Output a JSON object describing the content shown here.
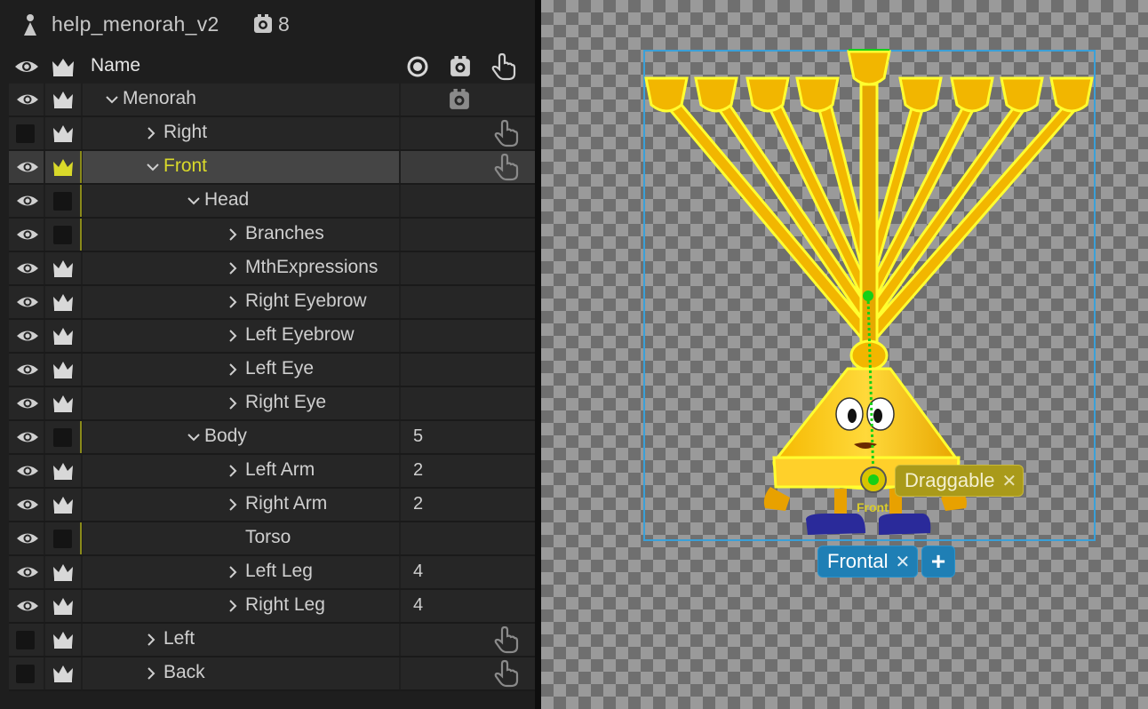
{
  "header": {
    "puppet_name": "help_menorah_v2",
    "count": "8"
  },
  "columns": {
    "name": "Name"
  },
  "rows": [
    {
      "label": "Menorah",
      "indent": 0,
      "expander": "open",
      "eye": true,
      "crown": "on",
      "yellow": false,
      "value": "",
      "icon": "gear"
    },
    {
      "label": "Right",
      "indent": 1,
      "expander": "closed",
      "eye": false,
      "crown": "on",
      "yellow": false,
      "value": "",
      "icon": "hand"
    },
    {
      "label": "Front",
      "indent": 1,
      "expander": "open",
      "eye": true,
      "crown": "yellow",
      "yellow": true,
      "value": "",
      "icon": "hand",
      "selected": true
    },
    {
      "label": "Head",
      "indent": 2,
      "expander": "open",
      "eye": true,
      "crown": "off",
      "yellow": false,
      "value": "",
      "icon": ""
    },
    {
      "label": "Branches",
      "indent": 3,
      "expander": "closed",
      "eye": true,
      "crown": "off",
      "yellow": false,
      "value": "",
      "icon": ""
    },
    {
      "label": "MthExpressions",
      "indent": 3,
      "expander": "closed",
      "eye": true,
      "crown": "on",
      "yellow": false,
      "value": "",
      "icon": ""
    },
    {
      "label": "Right Eyebrow",
      "indent": 3,
      "expander": "closed",
      "eye": true,
      "crown": "on",
      "yellow": false,
      "value": "",
      "icon": ""
    },
    {
      "label": "Left Eyebrow",
      "indent": 3,
      "expander": "closed",
      "eye": true,
      "crown": "on",
      "yellow": false,
      "value": "",
      "icon": ""
    },
    {
      "label": "Left Eye",
      "indent": 3,
      "expander": "closed",
      "eye": true,
      "crown": "on",
      "yellow": false,
      "value": "",
      "icon": ""
    },
    {
      "label": "Right Eye",
      "indent": 3,
      "expander": "closed",
      "eye": true,
      "crown": "on",
      "yellow": false,
      "value": "",
      "icon": ""
    },
    {
      "label": "Body",
      "indent": 2,
      "expander": "open",
      "eye": true,
      "crown": "off",
      "yellow": false,
      "value": "5",
      "icon": ""
    },
    {
      "label": "Left Arm",
      "indent": 3,
      "expander": "closed",
      "eye": true,
      "crown": "on",
      "yellow": false,
      "value": "2",
      "icon": ""
    },
    {
      "label": "Right Arm",
      "indent": 3,
      "expander": "closed",
      "eye": true,
      "crown": "on",
      "yellow": false,
      "value": "2",
      "icon": ""
    },
    {
      "label": "Torso",
      "indent": 3,
      "expander": "none",
      "eye": true,
      "crown": "off",
      "yellow": false,
      "value": "",
      "icon": ""
    },
    {
      "label": "Left Leg",
      "indent": 3,
      "expander": "closed",
      "eye": true,
      "crown": "on",
      "yellow": false,
      "value": "4",
      "icon": ""
    },
    {
      "label": "Right Leg",
      "indent": 3,
      "expander": "closed",
      "eye": true,
      "crown": "on",
      "yellow": false,
      "value": "4",
      "icon": ""
    },
    {
      "label": "Left",
      "indent": 1,
      "expander": "closed",
      "eye": false,
      "crown": "on",
      "yellow": false,
      "value": "",
      "icon": "hand"
    },
    {
      "label": "Back",
      "indent": 1,
      "expander": "closed",
      "eye": false,
      "crown": "on",
      "yellow": false,
      "value": "",
      "icon": "hand"
    }
  ],
  "canvas": {
    "draggable_tag": "Draggable",
    "frontal_tag": "Frontal",
    "handle_label": "Front",
    "close_glyph": "✕",
    "add_glyph": "+"
  },
  "colors": {
    "accent_yellow": "#d9d92a",
    "tag_blue": "#1f7fb5",
    "tag_olive": "#a99a1a",
    "bbox_blue": "#3aa0d8"
  }
}
